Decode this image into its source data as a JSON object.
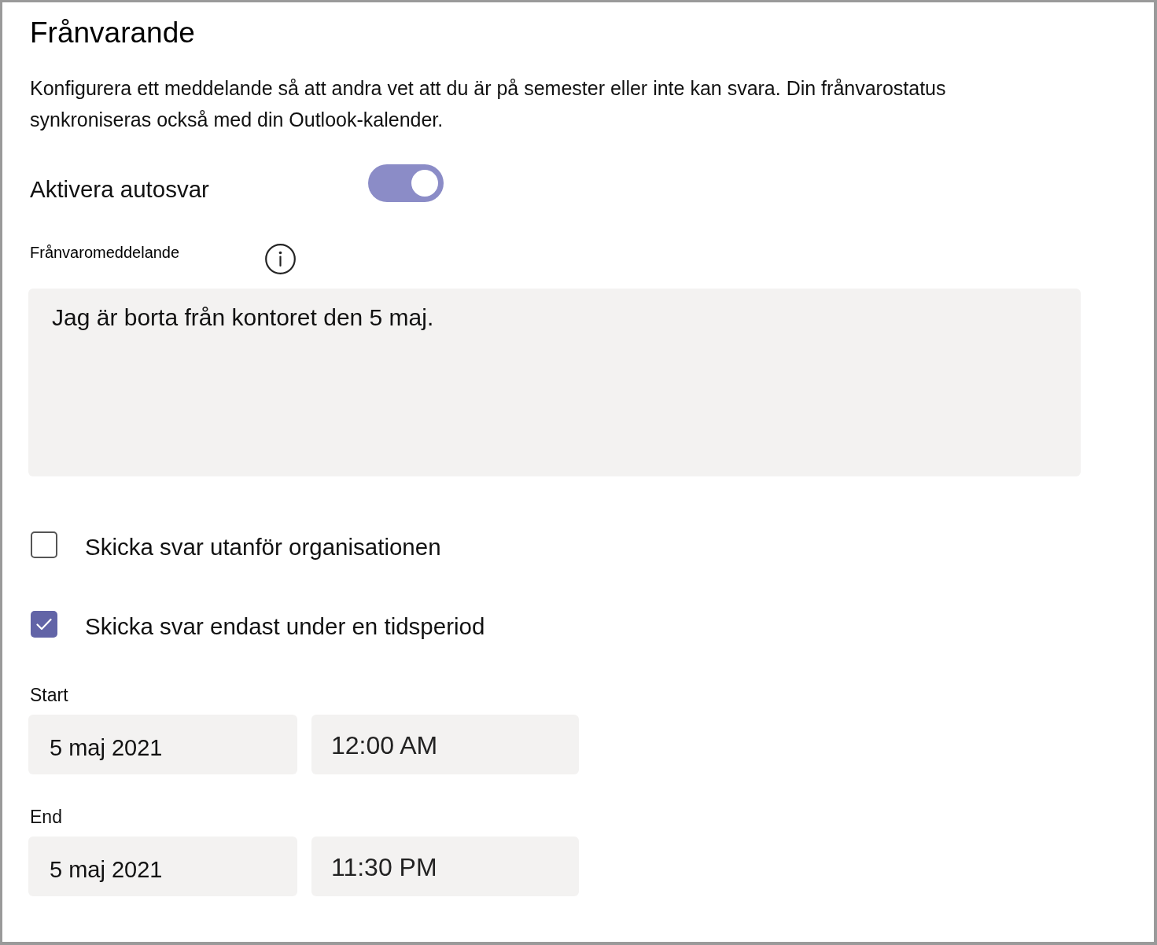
{
  "window": {
    "title": "Frånvarande",
    "description": "Konfigurera ett meddelande så att andra vet att du är på semester eller inte kan svara. Din frånvarostatus synkroniseras också med din Outlook-kalender."
  },
  "auto_reply": {
    "label": "Aktivera autosvar",
    "on": true
  },
  "message": {
    "label": "Frånvaromeddelande",
    "value": "Jag är borta från kontoret den 5 maj."
  },
  "options": [
    {
      "label": "Skicka svar utanför organisationen",
      "checked": false
    },
    {
      "label": "Skicka svar endast under en tidsperiod",
      "checked": true
    }
  ],
  "schedule": [
    {
      "label": "Start",
      "date": "5 maj 2021",
      "time": "12:00 AM"
    },
    {
      "label": "End",
      "date": "5 maj 2021",
      "time": "11:30 PM"
    }
  ]
}
